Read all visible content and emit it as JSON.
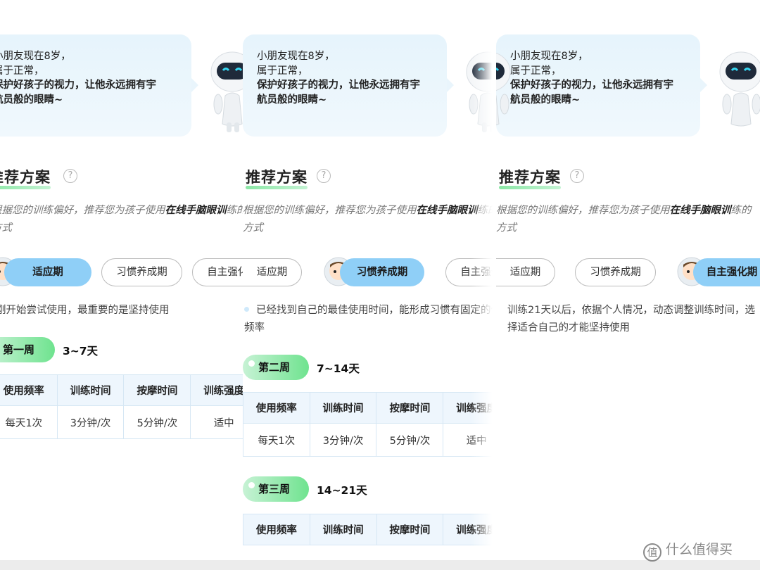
{
  "speech": {
    "line1": "小朋友现在8岁，",
    "line2": "属于正常，",
    "line3": "保护好孩子的视力，让他永远拥有宇",
    "line4": "航员般的眼睛~"
  },
  "section": {
    "title": "推荐方案",
    "help_symbol": "?",
    "desc_prefix": "根据您的训练偏好，推荐您为孩子使用",
    "desc_bold": "在线手脑眼训",
    "desc_suffix": "练的方式"
  },
  "phases": [
    "适应期",
    "习惯养成期",
    "自主强化期"
  ],
  "panels": [
    {
      "active_phase": 0,
      "note": "刚开始尝试使用，最重要的是坚持使用",
      "weeks": [
        {
          "label": "第一周",
          "range": "3~7天"
        }
      ]
    },
    {
      "active_phase": 1,
      "note": "已经找到自己的最佳使用时间，能形成习惯有固定的使用频率",
      "weeks": [
        {
          "label": "第二周",
          "range": "7~14天"
        },
        {
          "label": "第三周",
          "range": "14~21天"
        }
      ]
    },
    {
      "active_phase": 2,
      "note": "训练21天以后，依据个人情况，动态调整训练时间，选择适合自己的才能坚持使用",
      "weeks": []
    }
  ],
  "table": {
    "headers": [
      "使用频率",
      "训练时间",
      "按摩时间",
      "训练强度"
    ],
    "row": [
      "每天1次",
      "3分钟/次",
      "5分钟/次",
      "适中"
    ]
  },
  "watermark": {
    "icon_text": "值",
    "text": "什么值得买"
  },
  "colors": {
    "active_phase": "#8fcff7",
    "week_badge_end": "#6fe38f",
    "speech_bg": "#e6f4fc",
    "table_header_bg": "#eef6fd"
  }
}
